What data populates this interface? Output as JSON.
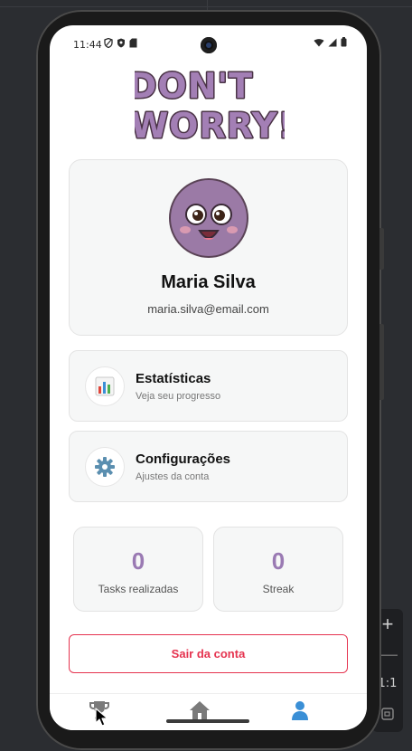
{
  "status_bar": {
    "time": "11:44"
  },
  "logo": {
    "line1": "DON'T",
    "line2": "WORRY!"
  },
  "profile": {
    "name": "Maria Silva",
    "email": "maria.silva@email.com"
  },
  "menu": [
    {
      "icon": "bar-chart-icon",
      "title": "Estatísticas",
      "subtitle": "Veja seu progresso"
    },
    {
      "icon": "gear-icon",
      "title": "Configurações",
      "subtitle": "Ajustes da conta"
    }
  ],
  "stats": [
    {
      "value": "0",
      "label": "Tasks realizadas"
    },
    {
      "value": "0",
      "label": "Streak"
    }
  ],
  "logout_label": "Sair da conta",
  "bottom_nav": [
    "trophy-icon",
    "home-icon",
    "user-icon"
  ],
  "emulator_toolbar": {
    "ratio_label": "1:1"
  },
  "colors": {
    "accent": "#9a7ab3",
    "danger": "#e5334f",
    "active_nav": "#3a8fd6"
  }
}
